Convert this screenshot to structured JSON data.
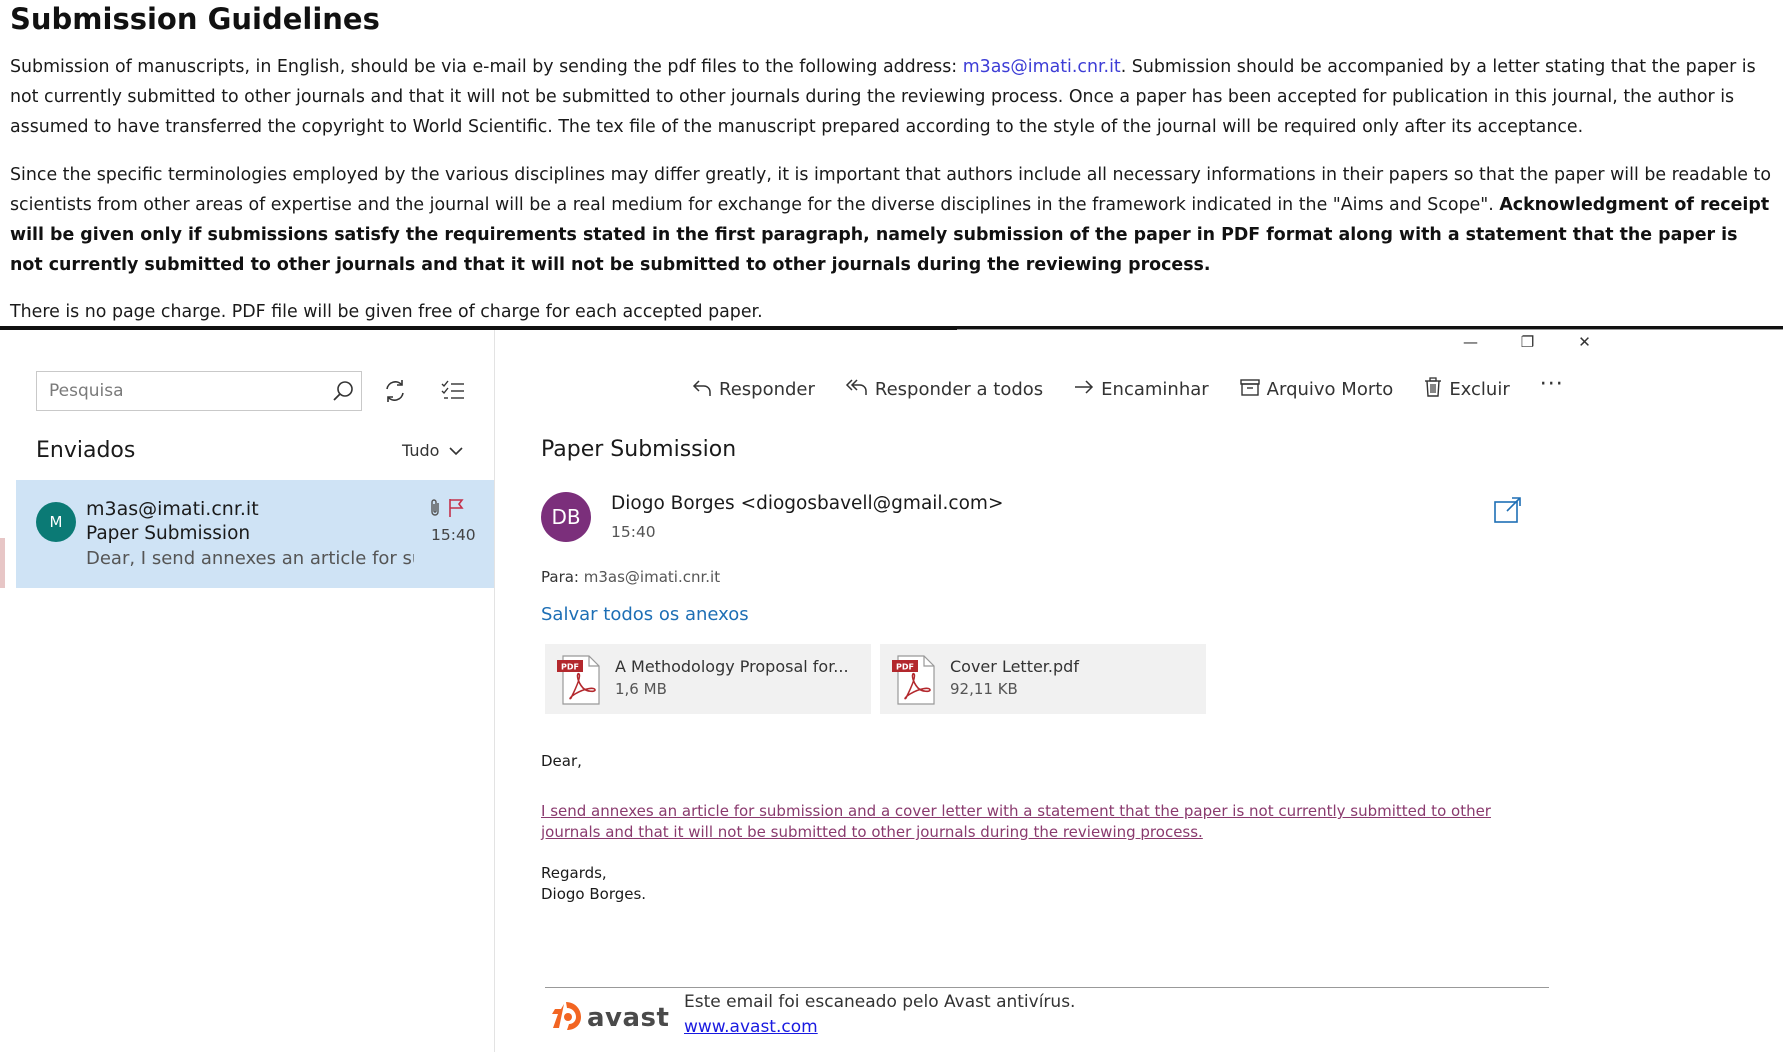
{
  "guidelines": {
    "title": "Submission Guidelines",
    "p1_before": "Submission of manuscripts, in English, should be via e-mail by sending the pdf files to the following address: ",
    "p1_email": "m3as@imati.cnr.it",
    "p1_after": ". Submission should be accompanied by a letter stating that the paper is not currently submitted to other journals and that it will not be submitted to other journals during the reviewing process. Once a paper has been accepted for publication in this journal, the author is assumed to have transferred the copyright to World Scientific. The tex file of the manuscript prepared according to the style of the journal will be required only after its acceptance.",
    "p2_normal": "Since the specific terminologies employed by the various disciplines may differ greatly, it is important that authors include all necessary informations in their papers so that the paper will be readable to scientists from other areas of expertise and the journal will be a real medium for exchange for the diverse disciplines in the framework indicated in the \"Aims and Scope\". ",
    "p2_bold": "Acknowledgment of receipt will be given only if submissions satisfy the requirements stated in the first paragraph, namely submission of the paper in PDF format along with a statement that the paper is not currently submitted to other journals and that it will not be submitted to other journals during the reviewing process.",
    "p3": "There is no page charge. PDF file will be given free of charge for each accepted paper."
  },
  "mail": {
    "window_controls": {
      "minimize": "—",
      "restore": "❐",
      "close": "✕"
    },
    "search": {
      "placeholder": "Pesquisa"
    },
    "folder": {
      "title": "Enviados",
      "filter": "Tudo"
    },
    "message_list": [
      {
        "avatar": "M",
        "from": "m3as@imati.cnr.it",
        "subject": "Paper Submission",
        "preview": "Dear, I send annexes an article for subm",
        "time": "15:40",
        "has_attachment_icon": "paperclip-icon",
        "flag_icon": "flag-icon",
        "avatar_color": "#0b7a75",
        "selected_bg": "#cfe3f5"
      }
    ],
    "toolbar": {
      "reply": "Responder",
      "reply_all": "Responder a todos",
      "forward": "Encaminhar",
      "archive": "Arquivo Morto",
      "delete": "Excluir",
      "more": "···"
    },
    "reading": {
      "subject": "Paper Submission",
      "sender_initials": "DB",
      "sender": "Diogo Borges <diogosbavell@gmail.com>",
      "time": "15:40",
      "to_label": "Para:",
      "to_value": "m3as@imati.cnr.it",
      "save_all": "Salvar todos os anexos",
      "attachments": [
        {
          "name": "A Methodology Proposal for...",
          "size": "1,6 MB",
          "icon": "pdf-file-icon"
        },
        {
          "name": "Cover Letter.pdf",
          "size": "92,11 KB",
          "icon": "pdf-file-icon"
        }
      ],
      "body": {
        "greeting": "Dear,",
        "message": "I send annexes an article for submission and a cover letter with a statement that the paper is not currently submitted to other journals and that it will not be submitted to other journals during the reviewing process.",
        "closing": "Regards,",
        "signature_name": "Diogo Borges."
      },
      "antivirus": {
        "brand": "avast",
        "text": "Este email foi escaneado pelo Avast antivírus.",
        "link": "www.avast.com",
        "brand_color": "#f26522"
      },
      "sender_avatar_color": "#7b2f7b",
      "accent": "#1e6fb5"
    }
  }
}
